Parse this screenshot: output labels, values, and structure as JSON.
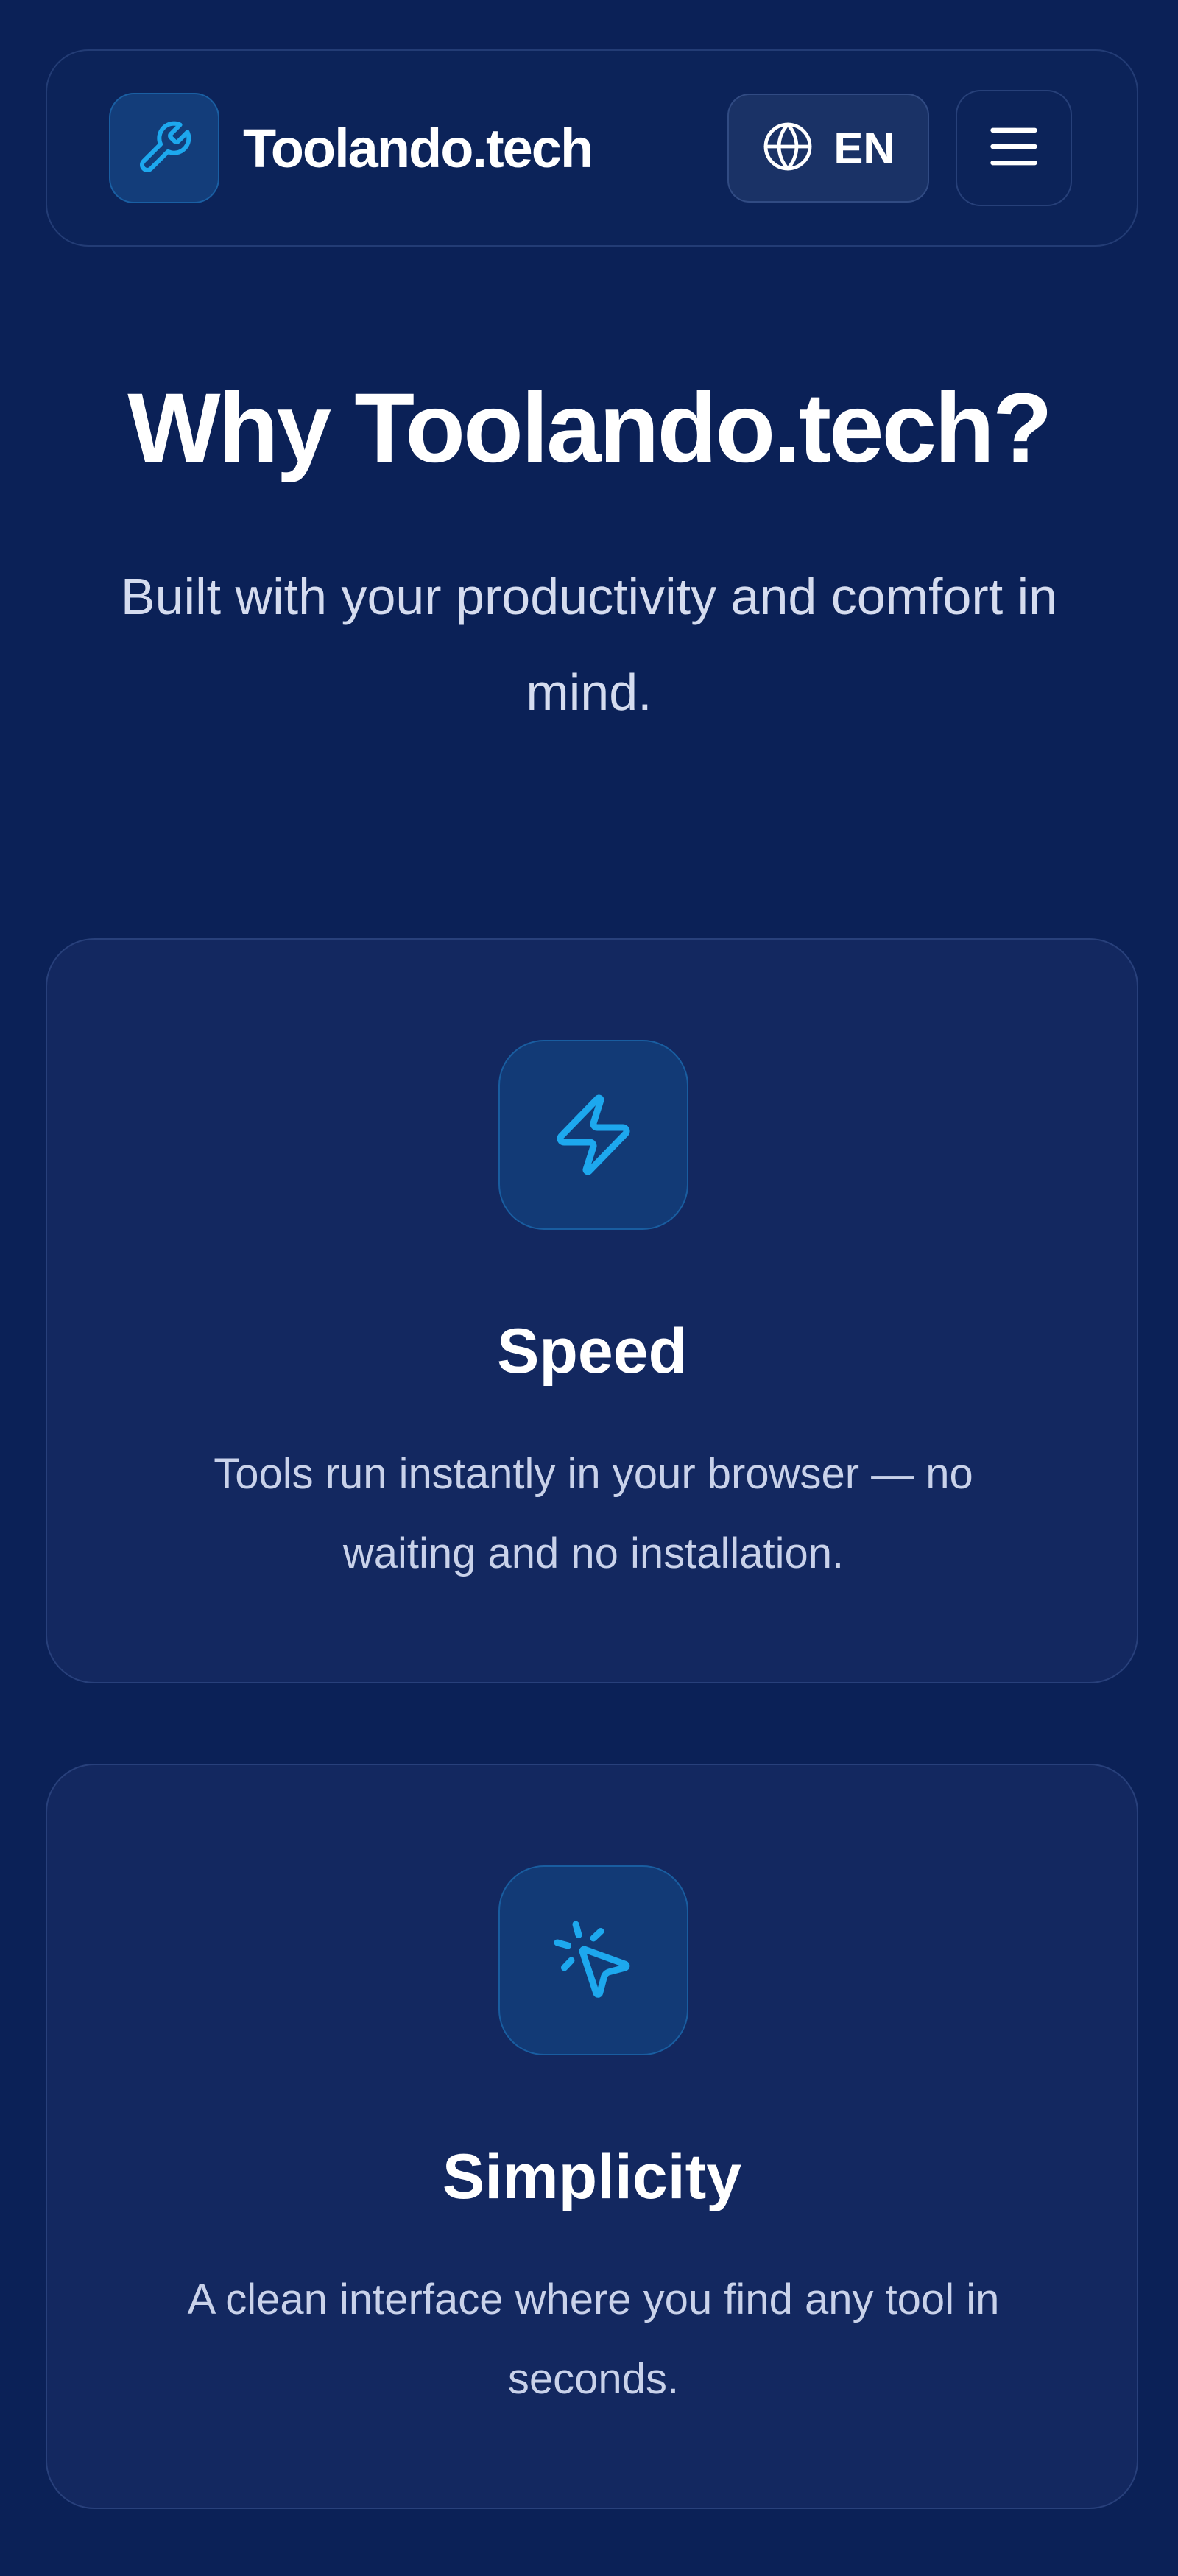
{
  "header": {
    "brand": "Toolando.tech",
    "language": "EN"
  },
  "hero": {
    "title": "Why Toolando.tech?",
    "subtitle": "Built with your productivity and comfort in mind."
  },
  "features": [
    {
      "icon": "lightning-bolt-icon",
      "title": "Speed",
      "description": "Tools run instantly in your browser — no waiting and no installation."
    },
    {
      "icon": "cursor-click-icon",
      "title": "Simplicity",
      "description": "A clean interface where you find any tool in seconds."
    }
  ],
  "colors": {
    "background": "#0b2157",
    "card": "#132860",
    "accent": "#1da8ee",
    "text": "#ffffff",
    "muted_text": "#c9d2ea"
  }
}
